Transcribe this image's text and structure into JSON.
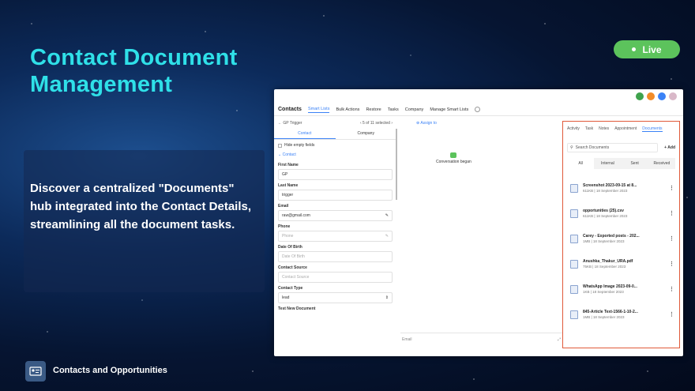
{
  "slide": {
    "title_line1": "Contact Document",
    "title_line2": "Management",
    "live_label": "Live",
    "description": "Discover a centralized \"Documents\" hub integrated into the Contact Details, streamlining all the document tasks.",
    "footer_label": "Contacts and Opportunities",
    "colors": {
      "accent": "#2fe0e8",
      "live": "#5cc35c",
      "highlight": "#e05a3a"
    }
  },
  "app": {
    "nav": {
      "title": "Contacts",
      "items": [
        "Smart Lists",
        "Bulk Actions",
        "Restore",
        "Tasks",
        "Company",
        "Manage Smart Lists"
      ]
    },
    "crumb": {
      "back": "← GP Trigger",
      "paging": "‹ 5 of 11 selected ›"
    },
    "subtabs": [
      "Contact",
      "Company"
    ],
    "hide_empty": "Hide empty fields",
    "section": "Contact",
    "fields": [
      {
        "label": "First Name",
        "value": "GP",
        "placeholder": false
      },
      {
        "label": "Last Name",
        "value": "trigger",
        "placeholder": false
      },
      {
        "label": "Email",
        "value": "raw@gmail.com",
        "placeholder": false
      },
      {
        "label": "Phone",
        "value": "Phone",
        "placeholder": true
      },
      {
        "label": "Date Of Birth",
        "value": "Date Of Birth",
        "placeholder": true
      },
      {
        "label": "Contact Source",
        "value": "Contact Source",
        "placeholder": true
      },
      {
        "label": "Contact Type",
        "value": "lead",
        "placeholder": false
      }
    ],
    "last_label": "Test New Document",
    "assign": "Assign to",
    "conversation": "Conversation began",
    "email_placeholder": "Email",
    "right_tabs": [
      "Activity",
      "Task",
      "Notes",
      "Appointment",
      "Documents"
    ],
    "search_placeholder": "Search Documents",
    "add_label": "+ Add",
    "filters": [
      "All",
      "Internal",
      "Sent",
      "Received"
    ],
    "documents": [
      {
        "name": "Screenshot 2023-09-15 at 8...",
        "meta": "611KB | 18 September 2023",
        "icon": "image-file-icon"
      },
      {
        "name": "opportunities (25).csv",
        "meta": "611KB | 18 September 2023",
        "icon": "csv-file-icon"
      },
      {
        "name": "Carey - Exported posts - 202...",
        "meta": "1MB | 18 September 2023",
        "icon": "csv-file-icon"
      },
      {
        "name": "Anushka_Thakur_URA.pdf",
        "meta": "75KB | 18 September 2023",
        "icon": "pdf-file-icon"
      },
      {
        "name": "WhatsApp Image 2023-09-0...",
        "meta": "1KB | 18 September 2023",
        "icon": "image-file-icon"
      },
      {
        "name": "845-Article Text-1566-1-10-2...",
        "meta": "1MB | 18 September 2023",
        "icon": "pdf-file-icon"
      }
    ]
  }
}
